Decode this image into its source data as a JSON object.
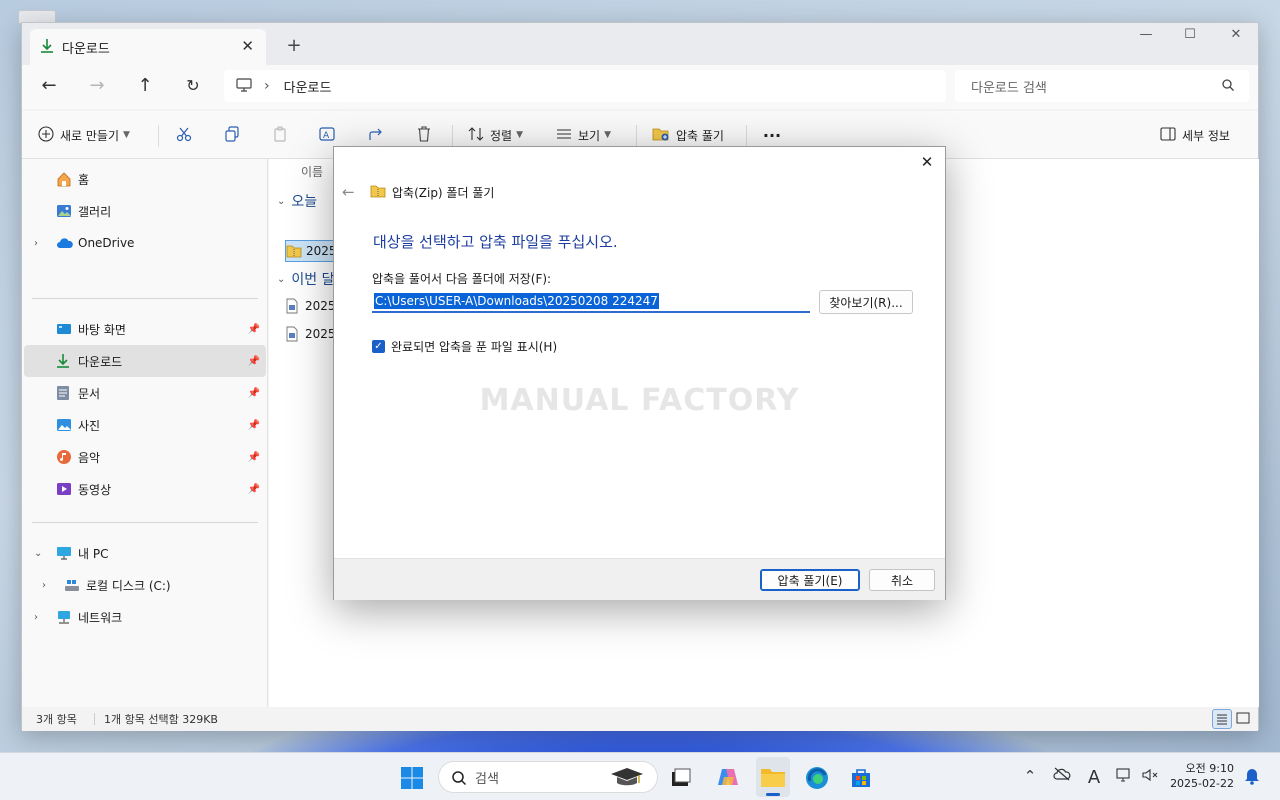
{
  "explorer": {
    "tab_title": "다운로드",
    "address_path": "다운로드",
    "search_placeholder": "다운로드 검색",
    "toolbar": {
      "new_label": "새로 만들기",
      "sort_label": "정렬",
      "view_label": "보기",
      "extract_label": "압축 풀기",
      "details_label": "세부 정보"
    },
    "sidebar": {
      "home": "홈",
      "gallery": "갤러리",
      "onedrive": "OneDrive",
      "desktop": "바탕 화면",
      "downloads": "다운로드",
      "documents": "문서",
      "pictures": "사진",
      "music": "음악",
      "videos": "동영상",
      "this_pc": "내 PC",
      "local_disk": "로컬 디스크 (C:)",
      "network": "네트워크"
    },
    "content": {
      "column_name": "이름",
      "group_today": "오늘",
      "group_month": "이번 달",
      "files": [
        "2025",
        "2025",
        "2025"
      ]
    },
    "status": {
      "item_count": "3개 항목",
      "selection": "1개 항목 선택함 329KB"
    }
  },
  "dialog": {
    "title": "압축(Zip) 폴더 풀기",
    "heading": "대상을 선택하고 압축 파일을 푸십시오.",
    "path_label": "압축을 풀어서 다음 폴더에 저장(F):",
    "path_value": "C:\\Users\\USER-A\\Downloads\\20250208 224247",
    "browse_label": "찾아보기(R)...",
    "checkbox_label": "완료되면 압축을 푼 파일 표시(H)",
    "checkbox_checked": true,
    "watermark": "MANUAL FACTORY",
    "extract_button": "압축 풀기(E)",
    "cancel_button": "취소"
  },
  "taskbar": {
    "search_placeholder": "검색",
    "clock_time": "오전 9:10",
    "clock_date": "2025-02-22"
  },
  "colors": {
    "accent": "#1b60c8",
    "heading": "#1d3e9e",
    "selection": "#0a64d8"
  }
}
